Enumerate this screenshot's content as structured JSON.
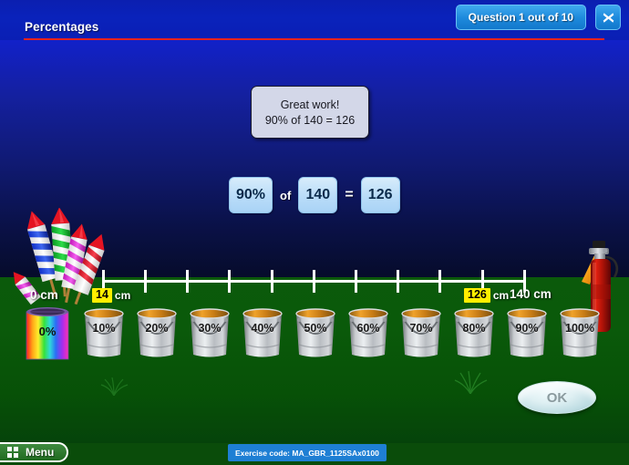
{
  "header": {
    "title": "Percentages",
    "question_badge": "Question 1 out of 10",
    "close_icon": "close-icon",
    "badge_color": "#1f8bdd",
    "rule_color": "#e8231c"
  },
  "feedback": {
    "line1": "Great work!",
    "line2": "90% of 140 = 126"
  },
  "equation": {
    "percent": "90%",
    "of_label": "of",
    "total": "140",
    "equals_label": "=",
    "result": "126"
  },
  "numberline": {
    "tick_count": 11,
    "labels": [
      {
        "value": "0 cm",
        "highlight": false
      },
      {
        "value": "14",
        "unit": "cm",
        "highlight": true
      },
      {
        "value": "126",
        "unit": "cm",
        "highlight": true
      },
      {
        "value": "140 cm",
        "highlight": false
      }
    ],
    "highlight_color": "#ffef00"
  },
  "buckets": [
    {
      "label": "0%",
      "type": "paint-can"
    },
    {
      "label": "10%",
      "type": "bucket"
    },
    {
      "label": "20%",
      "type": "bucket"
    },
    {
      "label": "30%",
      "type": "bucket"
    },
    {
      "label": "40%",
      "type": "bucket"
    },
    {
      "label": "50%",
      "type": "bucket"
    },
    {
      "label": "60%",
      "type": "bucket"
    },
    {
      "label": "70%",
      "type": "bucket"
    },
    {
      "label": "80%",
      "type": "bucket"
    },
    {
      "label": "90%",
      "type": "bucket"
    },
    {
      "label": "100%",
      "type": "bucket"
    }
  ],
  "scene": {
    "fireworks_icon": "fireworks-rockets-icon",
    "extinguisher_icon": "fire-extinguisher-icon",
    "sky_color": "#14209f",
    "ground_color": "#0a5a0a"
  },
  "ok_button": {
    "label": "OK"
  },
  "footer": {
    "menu_label": "Menu",
    "menu_icon": "grid-icon",
    "exercise_code": "Exercise code: MA_GBR_1125SAx0100"
  }
}
